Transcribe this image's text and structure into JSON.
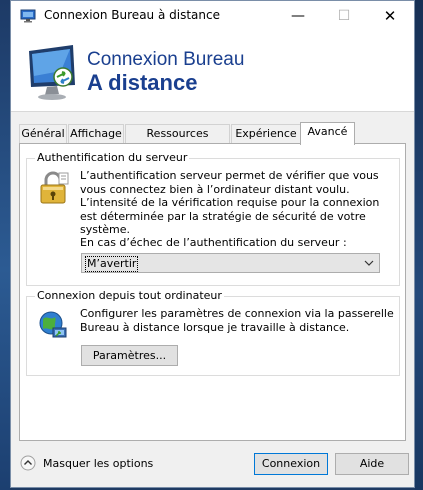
{
  "window": {
    "title": "Connexion Bureau à distance",
    "minimize_glyph": "—",
    "maximize_glyph": "☐",
    "close_glyph": "✕"
  },
  "banner": {
    "line1": "Connexion Bureau",
    "line2": "A distance",
    "icon": "remote-desktop-monitor-icon"
  },
  "tabs": [
    {
      "label": "Général",
      "active": false
    },
    {
      "label": "Affichage",
      "active": false
    },
    {
      "label": "Ressources locales",
      "active": false
    },
    {
      "label": "Expérience",
      "active": false
    },
    {
      "label": "Avancé",
      "active": true
    }
  ],
  "server_auth": {
    "legend": "Authentification du serveur",
    "description": "L’authentification serveur permet de vérifier que vous vous connectez bien à l’ordinateur distant voulu. L’intensité de la vérification requise pour la connexion est déterminée par la stratégie de sécurité de votre système.",
    "failure_label": "En cas d’échec de l’authentification du serveur :",
    "selected_option": "M’avertir",
    "icon": "padlock-icon"
  },
  "anywhere": {
    "legend": "Connexion depuis tout ordinateur",
    "description": "Configurer les paramètres de connexion via la passerelle Bureau à distance lorsque je travaille à distance.",
    "settings_button": "Paramètres...",
    "icon": "gateway-globe-icon"
  },
  "footer": {
    "options_toggle": "Masquer les options",
    "connect_button": "Connexion",
    "help_button": "Aide"
  },
  "colors": {
    "banner_text": "#1a3f8f",
    "accent_border": "#0078d7"
  }
}
